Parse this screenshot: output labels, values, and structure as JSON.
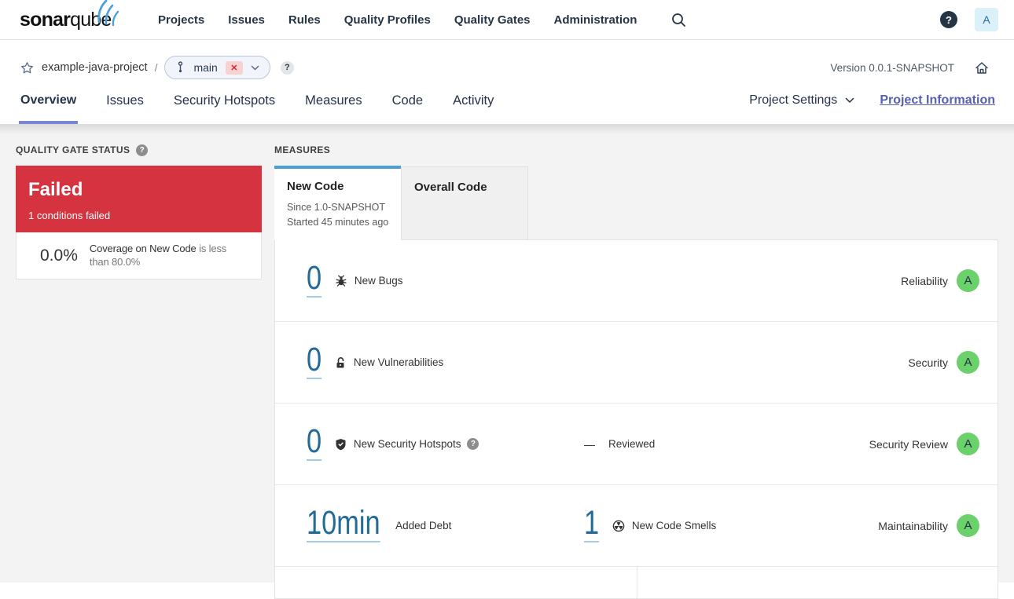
{
  "nav": {
    "logo_bold": "sonar",
    "logo_light": "qube",
    "items": [
      "Projects",
      "Issues",
      "Rules",
      "Quality Profiles",
      "Quality Gates",
      "Administration"
    ],
    "help": "?",
    "avatar": "A"
  },
  "breadcrumb": {
    "project": "example-java-project",
    "separator": "/",
    "branch": "main",
    "branch_badge": "✕",
    "help": "?",
    "version": "Version 0.0.1-SNAPSHOT"
  },
  "tabs": {
    "items": [
      "Overview",
      "Issues",
      "Security Hotspots",
      "Measures",
      "Code",
      "Activity"
    ],
    "active": "Overview",
    "settings_label": "Project Settings",
    "info_label": "Project Information"
  },
  "quality_gate": {
    "title": "QUALITY GATE STATUS",
    "help": "?",
    "status": "Failed",
    "conditions_summary": "1 conditions failed",
    "condition_value": "0.0%",
    "condition_metric": "Coverage on New Code",
    "condition_rest": " is less than 80.0%"
  },
  "measures": {
    "title": "MEASURES",
    "tab_new_code": "New Code",
    "tab_new_code_line1": "Since 1.0-SNAPSHOT",
    "tab_new_code_line2": "Started 45 minutes ago",
    "tab_overall": "Overall Code",
    "rows": {
      "bugs": {
        "value": "0",
        "label": "New Bugs",
        "icon": "bug-icon",
        "rating_label": "Reliability",
        "rating": "A"
      },
      "vulnerabilities": {
        "value": "0",
        "label": "New Vulnerabilities",
        "icon": "lock-open-icon",
        "rating_label": "Security",
        "rating": "A"
      },
      "hotspots": {
        "value": "0",
        "label": "New Security Hotspots",
        "icon": "shield-icon",
        "help": "?",
        "reviewed_dash": "—",
        "reviewed_label": "Reviewed",
        "rating_label": "Security Review",
        "rating": "A"
      },
      "debt": {
        "value": "10min",
        "label": "Added Debt",
        "value2": "1",
        "label2": "New Code Smells",
        "icon2": "code-smell-icon",
        "rating_label": "Maintainability",
        "rating": "A"
      }
    }
  },
  "colors": {
    "qg-red": "#d4333f",
    "tab-blue": "#4b9fd5",
    "link-blue": "#236a97",
    "rating-green": "#6bd16b"
  }
}
